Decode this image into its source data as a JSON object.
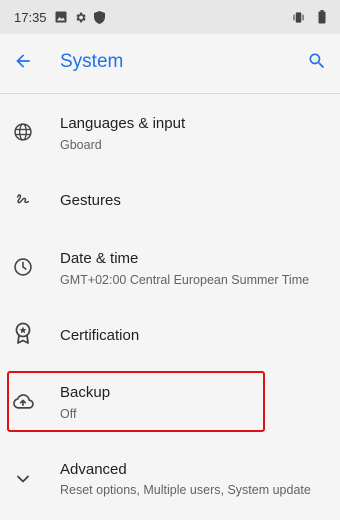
{
  "status_bar": {
    "time": "17:35",
    "left_icons": [
      "image-icon",
      "gear-icon",
      "shield-icon"
    ],
    "right_icons": [
      "vibrate-icon",
      "battery-icon"
    ]
  },
  "app_bar": {
    "title": "System",
    "accent_color": "#1a73e8"
  },
  "items": [
    {
      "icon": "globe-icon",
      "title": "Languages & input",
      "subtitle": "Gboard"
    },
    {
      "icon": "gestures-icon",
      "title": "Gestures",
      "subtitle": ""
    },
    {
      "icon": "clock-icon",
      "title": "Date & time",
      "subtitle": "GMT+02:00 Central European Summer Time"
    },
    {
      "icon": "certificate-icon",
      "title": "Certification",
      "subtitle": ""
    },
    {
      "icon": "cloud-upload-icon",
      "title": "Backup",
      "subtitle": "Off",
      "highlighted": true
    },
    {
      "icon": "chevron-down-icon",
      "title": "Advanced",
      "subtitle": "Reset options, Multiple users, System update"
    }
  ],
  "highlight_color": "#e01010"
}
